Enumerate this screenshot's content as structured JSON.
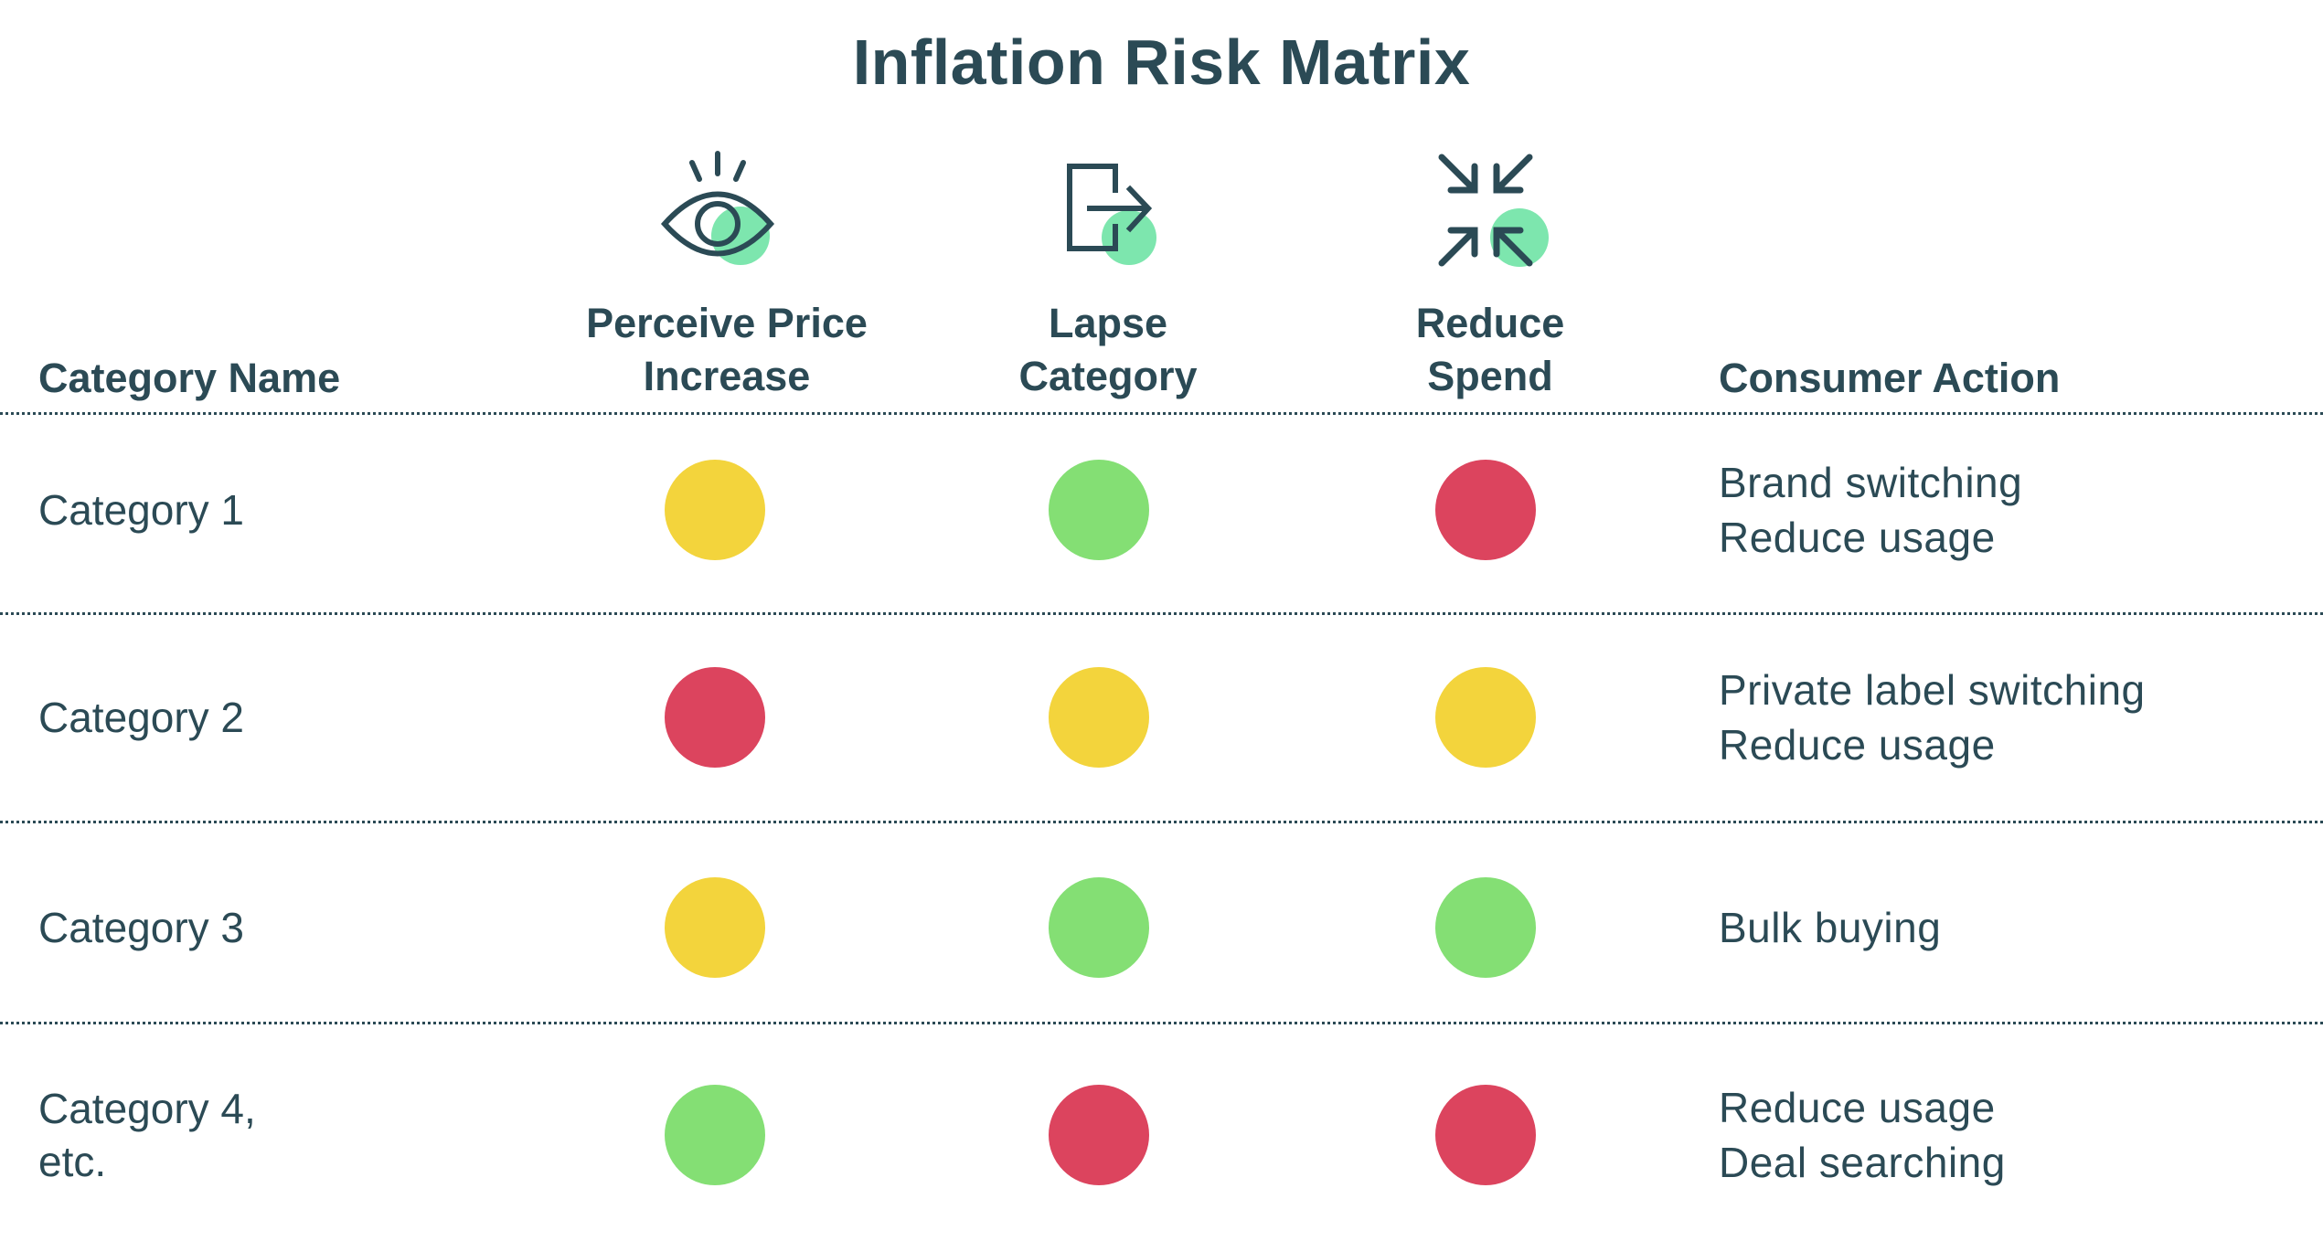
{
  "title": "Inflation Risk Matrix",
  "colors": {
    "text": "#2b4a55",
    "high": "#dc445e",
    "medium": "#f3d43c",
    "low": "#84df74",
    "icon_accent": "#7de6ae"
  },
  "headers": {
    "category_name": "Category Name",
    "columns": [
      {
        "line1": "Perceive Price",
        "line2": "Increase",
        "icon": "eye-icon"
      },
      {
        "line1": "Lapse",
        "line2": "Category",
        "icon": "exit-icon"
      },
      {
        "line1": "Reduce",
        "line2": "Spend",
        "icon": "compress-arrows-icon"
      }
    ],
    "consumer_action": "Consumer Action"
  },
  "rows": [
    {
      "category_line1": "Category 1",
      "category_line2": "",
      "ratings": [
        "medium",
        "low",
        "high"
      ],
      "action_line1": "Brand switching",
      "action_line2": "Reduce usage"
    },
    {
      "category_line1": "Category 2",
      "category_line2": "",
      "ratings": [
        "high",
        "medium",
        "medium"
      ],
      "action_line1": "Private label switching",
      "action_line2": "Reduce usage"
    },
    {
      "category_line1": "Category 3",
      "category_line2": "",
      "ratings": [
        "medium",
        "low",
        "low"
      ],
      "action_line1": "Bulk buying",
      "action_line2": ""
    },
    {
      "category_line1": "Category 4,",
      "category_line2": "etc.",
      "ratings": [
        "low",
        "high",
        "high"
      ],
      "action_line1": "Reduce usage",
      "action_line2": "Deal searching"
    }
  ]
}
